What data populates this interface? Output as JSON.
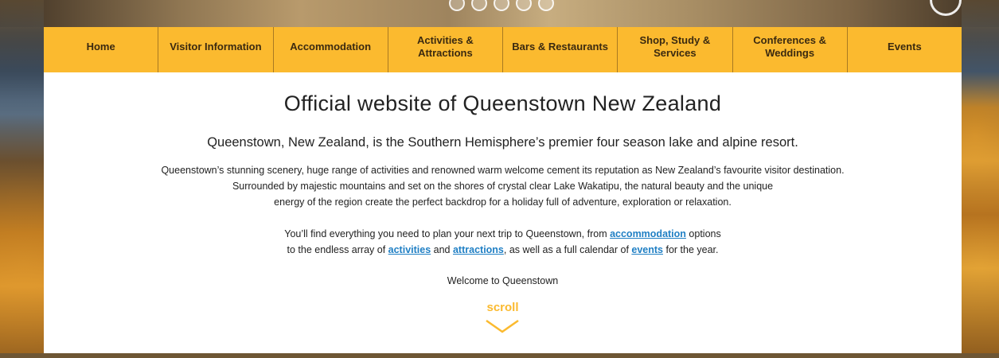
{
  "nav": {
    "items": [
      {
        "label": "Home"
      },
      {
        "label": "Visitor Information"
      },
      {
        "label": "Accommodation"
      },
      {
        "label": "Activities &\nAttractions"
      },
      {
        "label": "Bars & Restaurants"
      },
      {
        "label": "Shop, Study &\nServices"
      },
      {
        "label": "Conferences &\nWeddings"
      },
      {
        "label": "Events"
      }
    ]
  },
  "main": {
    "title": "Official website of Queenstown New Zealand",
    "subtitle": "Queenstown, New Zealand, is the Southern Hemisphere’s premier four season lake and alpine resort.",
    "p1_line1": "Queenstown’s stunning scenery, huge range of activities and renowned warm welcome cement its reputation as New Zealand’s favourite visitor destination.",
    "p1_line2": "Surrounded by majestic mountains and set on the shores of crystal clear Lake Wakatipu, the natural beauty and the unique",
    "p1_line3": "energy of the region create the perfect backdrop for a holiday full of adventure, exploration or relaxation.",
    "p2_a": "You’ll find everything you need to plan your next trip to Queenstown, from ",
    "p2_link_accommodation": "accommodation",
    "p2_b": " options",
    "p2_c": "to the endless array of ",
    "p2_link_activities": "activities",
    "p2_d": " and ",
    "p2_link_attractions": "attractions",
    "p2_e": ", as well as a full calendar of ",
    "p2_link_events": "events",
    "p2_f": " for the year.",
    "welcome": "Welcome to Queenstown",
    "scroll_label": "scroll"
  },
  "colors": {
    "nav_bg": "#fbba2f",
    "link": "#1f7fc4",
    "scroll": "#fbba2f"
  }
}
